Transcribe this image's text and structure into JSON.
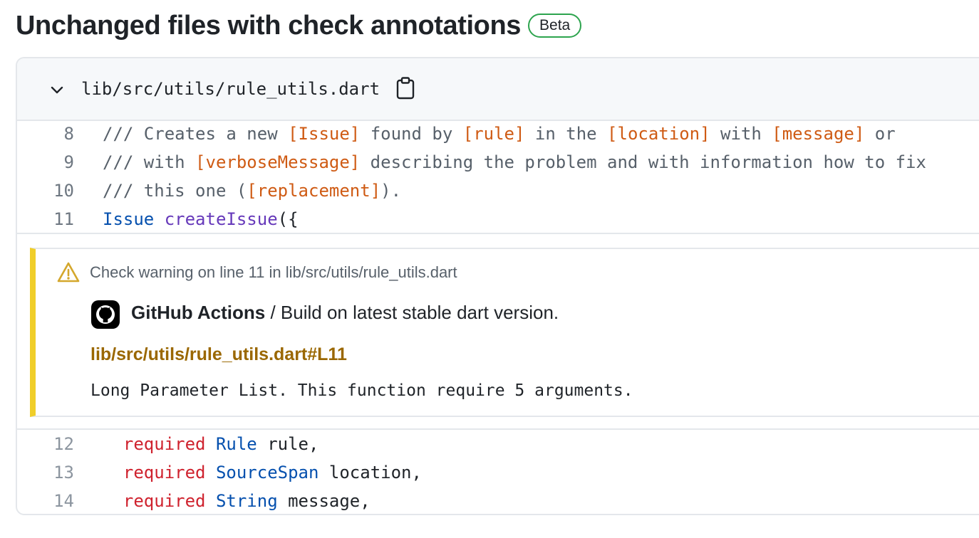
{
  "header": {
    "title": "Unchanged files with check annotations",
    "badge": "Beta"
  },
  "file": {
    "path": "lib/src/utils/rule_utils.dart"
  },
  "code_before": [
    {
      "line": "8",
      "parts": [
        {
          "t": "/// Creates a new ",
          "c": "cm"
        },
        {
          "t": "[Issue]",
          "c": "ref"
        },
        {
          "t": " found by ",
          "c": "cm"
        },
        {
          "t": "[rule]",
          "c": "ref"
        },
        {
          "t": " in the ",
          "c": "cm"
        },
        {
          "t": "[location]",
          "c": "ref"
        },
        {
          "t": " with ",
          "c": "cm"
        },
        {
          "t": "[message]",
          "c": "ref"
        },
        {
          "t": " or",
          "c": "cm"
        }
      ]
    },
    {
      "line": "9",
      "parts": [
        {
          "t": "/// with ",
          "c": "cm"
        },
        {
          "t": "[verboseMessage]",
          "c": "ref"
        },
        {
          "t": " describing the problem and with information how to fix",
          "c": "cm"
        }
      ]
    },
    {
      "line": "10",
      "parts": [
        {
          "t": "/// this one (",
          "c": "cm"
        },
        {
          "t": "[replacement]",
          "c": "ref"
        },
        {
          "t": ").",
          "c": "cm"
        }
      ]
    },
    {
      "line": "11",
      "parts": [
        {
          "t": "Issue",
          "c": "ty"
        },
        {
          "t": " ",
          "c": ""
        },
        {
          "t": "createIssue",
          "c": "fn"
        },
        {
          "t": "({",
          "c": ""
        }
      ]
    }
  ],
  "annotation": {
    "warning": "Check warning on line 11 in lib/src/utils/rule_utils.dart",
    "app": "GitHub Actions",
    "workflow": " / Build on latest stable dart version.",
    "link": "lib/src/utils/rule_utils.dart#L11",
    "message": "Long Parameter List. This function require 5 arguments."
  },
  "code_after": [
    {
      "line": "12",
      "parts": [
        {
          "t": "  required",
          "c": "kw"
        },
        {
          "t": " ",
          "c": ""
        },
        {
          "t": "Rule",
          "c": "ty"
        },
        {
          "t": " rule,",
          "c": ""
        }
      ]
    },
    {
      "line": "13",
      "parts": [
        {
          "t": "  required",
          "c": "kw"
        },
        {
          "t": " ",
          "c": ""
        },
        {
          "t": "SourceSpan",
          "c": "ty"
        },
        {
          "t": " location,",
          "c": ""
        }
      ]
    },
    {
      "line": "14",
      "parts": [
        {
          "t": "  required",
          "c": "kw"
        },
        {
          "t": " ",
          "c": ""
        },
        {
          "t": "String",
          "c": "ty"
        },
        {
          "t": " message,",
          "c": ""
        }
      ]
    }
  ]
}
